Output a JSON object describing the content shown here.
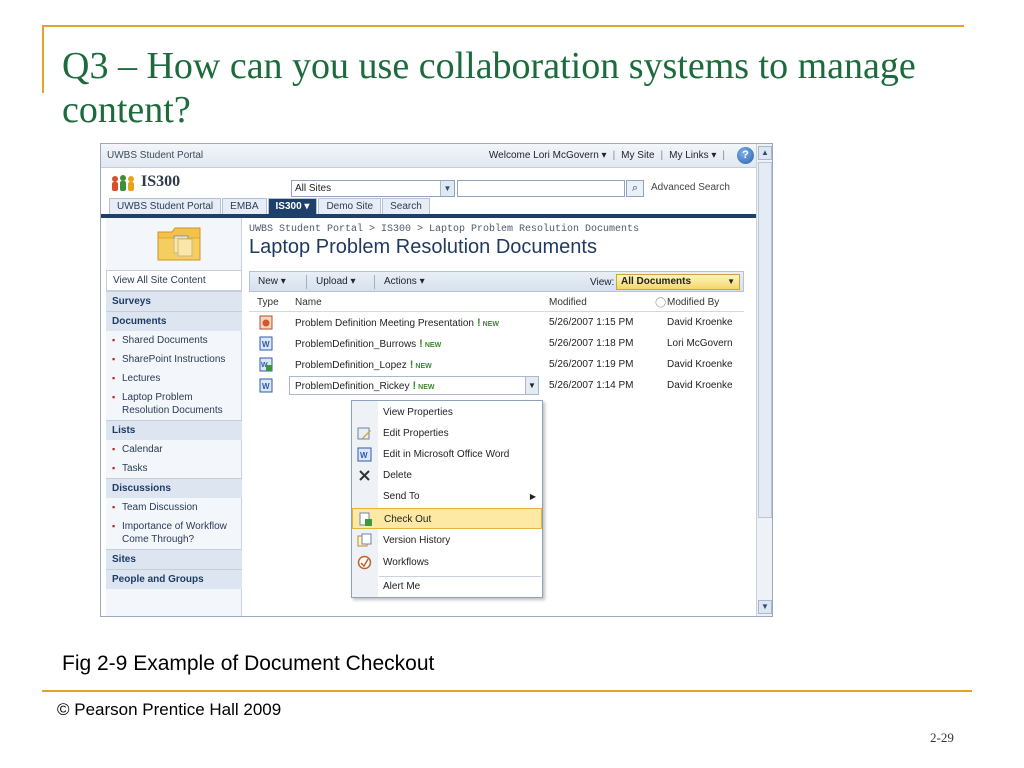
{
  "slide": {
    "title": "Q3 – How can you use collaboration systems to manage content?",
    "caption": "Fig 2-9 Example of Document Checkout",
    "copyright": "© Pearson Prentice Hall 2009",
    "page_number": "2-29"
  },
  "portal": {
    "name": "UWBS Student Portal",
    "welcome": "Welcome Lori McGovern ▾",
    "my_site": "My Site",
    "my_links": "My Links ▾",
    "help": "?"
  },
  "site": {
    "name": "IS300",
    "scope_value": "All Sites",
    "advanced_search": "Advanced Search"
  },
  "tabs": [
    {
      "label": "UWBS Student Portal"
    },
    {
      "label": "EMBA"
    },
    {
      "label": "IS300 ▾"
    },
    {
      "label": "Demo Site"
    },
    {
      "label": "Search"
    }
  ],
  "page": {
    "breadcrumb": "UWBS Student Portal > IS300 > Laptop Problem Resolution Documents",
    "heading": "Laptop Problem Resolution Documents"
  },
  "nav": {
    "view_all": "View All Site Content",
    "surveys": "Surveys",
    "documents": "Documents",
    "doc_items": [
      "Shared Documents",
      "SharePoint Instructions",
      "Lectures",
      "Laptop Problem Resolution Documents"
    ],
    "lists": "Lists",
    "list_items": [
      "Calendar",
      "Tasks"
    ],
    "discussions": "Discussions",
    "discussion_items": [
      "Team Discussion",
      "Importance of Workflow Come Through?"
    ],
    "sites": "Sites",
    "people": "People and Groups"
  },
  "toolbar": {
    "new": "New ▾",
    "upload": "Upload ▾",
    "actions": "Actions ▾",
    "view_label": "View:",
    "view_value": "All Documents"
  },
  "table": {
    "headers": {
      "type": "Type",
      "name": "Name",
      "modified": "Modified",
      "modified_by": "Modified By"
    },
    "new_badge": "NEW",
    "rows": [
      {
        "name": "Problem Definition Meeting Presentation",
        "modified": "5/26/2007 1:15 PM",
        "modified_by": "David Kroenke"
      },
      {
        "name": "ProblemDefinition_Burrows",
        "modified": "5/26/2007 1:18 PM",
        "modified_by": "Lori McGovern"
      },
      {
        "name": "ProblemDefinition_Lopez",
        "modified": "5/26/2007 1:19 PM",
        "modified_by": "David Kroenke"
      },
      {
        "name": "ProblemDefinition_Rickey",
        "modified": "5/26/2007 1:14 PM",
        "modified_by": "David Kroenke"
      }
    ]
  },
  "context_menu": {
    "items": [
      "View Properties",
      "Edit Properties",
      "Edit in Microsoft Office Word",
      "Delete",
      "Send To",
      "Check Out",
      "Version History",
      "Workflows",
      "Alert Me"
    ]
  },
  "colors": {
    "title_green": "#1d6b3c",
    "rule_gold": "#e0a42e",
    "nav_blue": "#1f3f6b",
    "highlight": "#fde9a4"
  }
}
